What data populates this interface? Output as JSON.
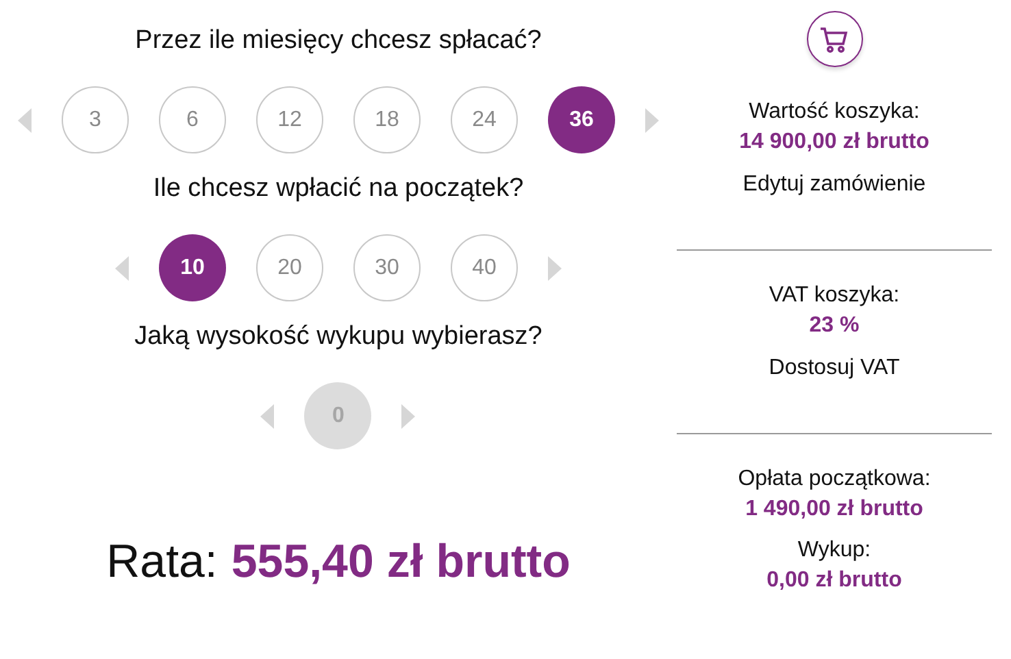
{
  "groups": [
    {
      "question": "Przez ile miesięcy chcesz spłacać?",
      "disabled": false,
      "options": [
        {
          "label": "3",
          "selected": false
        },
        {
          "label": "6",
          "selected": false
        },
        {
          "label": "12",
          "selected": false
        },
        {
          "label": "18",
          "selected": false
        },
        {
          "label": "24",
          "selected": false
        },
        {
          "label": "36",
          "selected": true
        }
      ]
    },
    {
      "question": "Ile chcesz wpłacić na początek?",
      "disabled": false,
      "options": [
        {
          "label": "10",
          "selected": true
        },
        {
          "label": "20",
          "selected": false
        },
        {
          "label": "30",
          "selected": false
        },
        {
          "label": "40",
          "selected": false
        }
      ]
    },
    {
      "question": "Jaką wysokość wykupu wybierasz?",
      "disabled": true,
      "options": [
        {
          "label": "0",
          "selected": true
        }
      ]
    }
  ],
  "installment": {
    "label": "Rata:",
    "value": "555,40 zł brutto"
  },
  "summary": [
    {
      "items": [
        {
          "label": "Wartość koszyka:",
          "value": "14 900,00 zł brutto"
        }
      ],
      "link": "Edytuj zamówienie"
    },
    {
      "items": [
        {
          "label": "VAT koszyka:",
          "value": "23 %"
        }
      ],
      "link": "Dostosuj VAT"
    },
    {
      "items": [
        {
          "label": "Opłata początkowa:",
          "value": "1 490,00 zł brutto"
        },
        {
          "label": "Wykup:",
          "value": "0,00 zł brutto"
        }
      ]
    }
  ]
}
